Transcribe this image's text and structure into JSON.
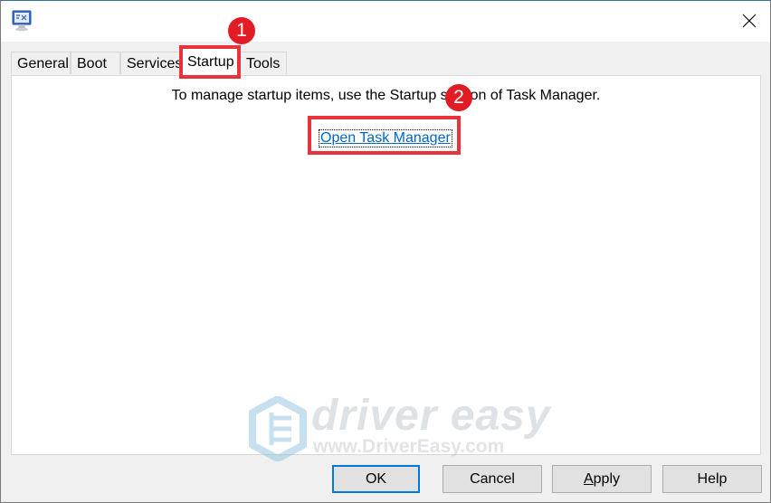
{
  "window": {
    "icon": "system-configuration-icon",
    "close_icon": "close-icon"
  },
  "tabs": [
    {
      "label": "General",
      "selected": false
    },
    {
      "label": "Boot",
      "selected": false
    },
    {
      "label": "Services",
      "selected": false
    },
    {
      "label": "Startup",
      "selected": true
    },
    {
      "label": "Tools",
      "selected": false
    }
  ],
  "startup_panel": {
    "message": "To manage startup items, use the Startup section of Task Manager.",
    "link_label": "Open Task Manager"
  },
  "buttons": {
    "ok": "OK",
    "cancel": "Cancel",
    "apply": "Apply",
    "help": "Help"
  },
  "annotations": {
    "step1": "1",
    "step2": "2",
    "color": "#e8323c"
  },
  "watermark": {
    "brand": "driver easy",
    "url": "www.DriverEasy.com"
  }
}
